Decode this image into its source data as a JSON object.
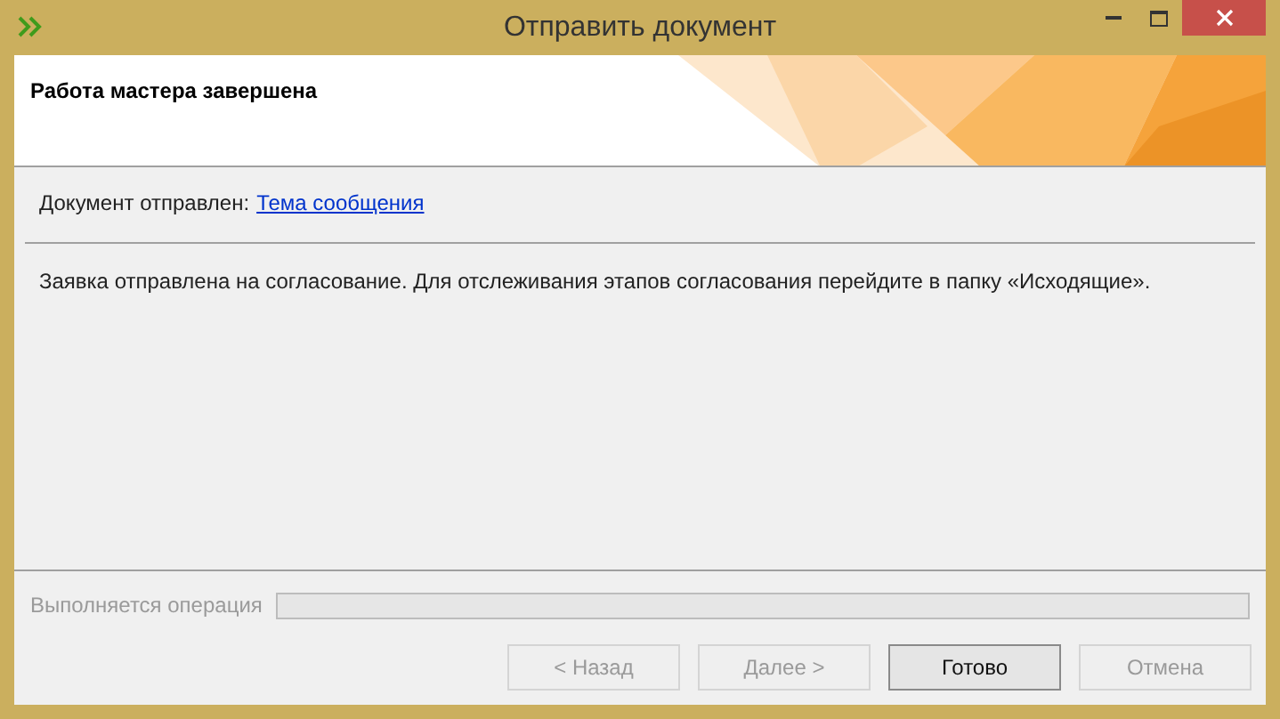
{
  "window": {
    "title": "Отправить документ"
  },
  "header": {
    "title": "Работа мастера завершена"
  },
  "sent_line": {
    "label": "Документ отправлен:",
    "link": "Тема сообщения"
  },
  "message": "Заявка отправлена на согласование. Для отслеживания этапов согласования перейдите в папку «Исходящие».",
  "progress": {
    "label": "Выполняется операция",
    "disabled": true,
    "level": 0
  },
  "buttons": [
    {
      "label": "< Назад",
      "disabled": true,
      "default": false
    },
    {
      "label": "Далее >",
      "disabled": true,
      "default": false
    },
    {
      "label": "Готово",
      "disabled": false,
      "default": true
    },
    {
      "label": "Отмена",
      "disabled": true,
      "default": false
    }
  ]
}
